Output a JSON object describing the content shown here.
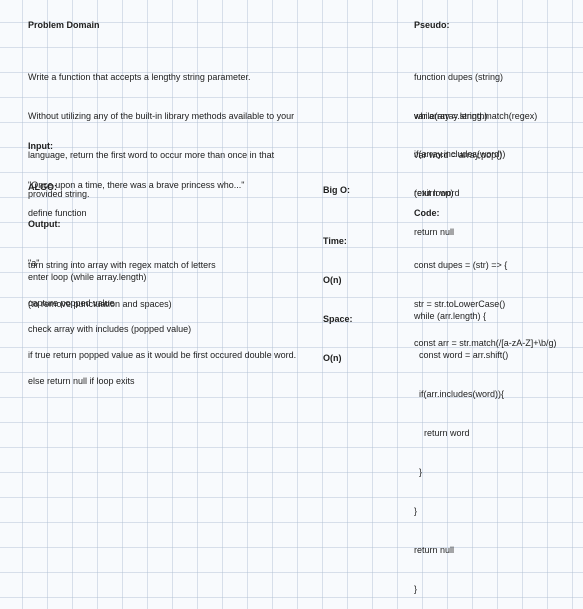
{
  "problem_domain": {
    "heading": "Problem Domain",
    "lines": [
      "Write a function that accepts a lengthy string parameter.",
      "Without utilizing any of the built-in library methods available to your",
      "language, return the first word to occur more than once in that",
      "provided string."
    ]
  },
  "input": {
    "label": "Input:",
    "value": "\"Once upon a time, there was a brave princess who...\""
  },
  "output": {
    "label": "Output:",
    "value": "\"a\""
  },
  "algo": {
    "heading": "ALGO:",
    "steps": [
      "define function",
      "turn string into array with regex match of letters",
      "(to remove punctuation and spaces)",
      "enter loop (while array.length)",
      "capture popped value",
      "check array with includes (popped value)",
      "if true return popped value as it would be first occured double word.",
      "else return null if loop exits"
    ]
  },
  "big_o": {
    "heading": "Big O:",
    "time_label": "Time:",
    "time_value": "O(n)",
    "space_label": "Space:",
    "space_value": "O(n)"
  },
  "pseudo": {
    "heading": "Pseudo:",
    "lines": [
      "function dupes (string)",
      "var array = string.match(regex)",
      "while(array.length)",
      "var word = array.pop()",
      "if(array.includes(word))",
      "return word",
      "(exit loop)",
      "return null"
    ]
  },
  "code": {
    "heading": "Code:",
    "lines": [
      "const dupes = (str) => {",
      "str = str.toLowerCase()",
      "const arr = str.match(/[a-zA-Z]+\\b/g)",
      "while (arr.length) {",
      "  const word = arr.shift()",
      "  if(arr.includes(word)){",
      "    return word",
      "  }",
      "}",
      "return null",
      "}"
    ]
  }
}
